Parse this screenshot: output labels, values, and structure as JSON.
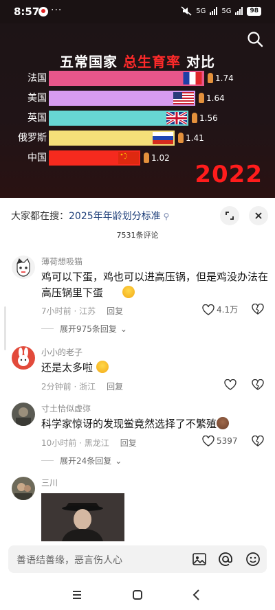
{
  "status": {
    "time": "8:57",
    "more": "···",
    "net1": "5G",
    "net2": "5G",
    "battery": "98"
  },
  "video": {
    "title_prefix": "五常国家 ",
    "title_highlight": "总生育率",
    "title_suffix": " 对比",
    "year": "2022",
    "chart_data": {
      "type": "bar",
      "categories": [
        "法国",
        "美国",
        "英国",
        "俄罗斯",
        "中国"
      ],
      "values": [
        1.74,
        1.64,
        1.56,
        1.41,
        1.02
      ],
      "value_labels": [
        "1.74",
        "1.64",
        "1.56",
        "1.41",
        "1.02"
      ],
      "colors": [
        "#e8568a",
        "#d79cf0",
        "#67d6d3",
        "#f4df79",
        "#f52a1e"
      ],
      "flags": [
        "france-flag-icon",
        "usa-flag-icon",
        "uk-flag-icon",
        "russia-flag-icon",
        "china-flag-icon"
      ],
      "title": "五常国家 总生育率 对比",
      "xlim": [
        0,
        2.0
      ]
    }
  },
  "sheet": {
    "trend_label": "大家都在搜：",
    "trend_keyword": "2025年年龄划分标准",
    "comment_count": "7531条评论"
  },
  "comments": [
    {
      "name": "薄荷想吸猫",
      "text": "鸡可以下蛋，鸡也可以进高压锅，但是鸡没办法在高压锅里下蛋",
      "time": "7小时前 · 江苏",
      "reply": "回复",
      "likes": "4.1万",
      "expand": "展开975条回复"
    },
    {
      "name": "小小的老子",
      "text": "还是太多啦",
      "time": "2分钟前 · 浙江",
      "reply": "回复",
      "likes": ""
    },
    {
      "name": "寸土恰似虚弥",
      "text": "科学家惊讶的发现鲎竟然选择了不繁殖",
      "time": "10小时前 · 黑龙江",
      "reply": "回复",
      "likes": "5397",
      "expand": "展开24条回复"
    },
    {
      "name": "三川"
    }
  ],
  "input": {
    "placeholder": "善语结善缘，恶言伤人心"
  }
}
